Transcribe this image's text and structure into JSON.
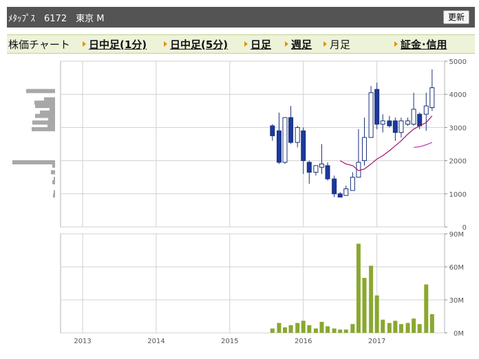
{
  "header": {
    "title": "ﾒﾀｯﾌﾟｽ　6172　東京 M",
    "refresh_label": "更新"
  },
  "nav": {
    "label": "株価チャート",
    "items": [
      {
        "label": "日中足(1分)",
        "link": true
      },
      {
        "label": "日中足(5分)",
        "link": true
      },
      {
        "label": "日足",
        "link": true
      },
      {
        "label": "週足",
        "link": true
      },
      {
        "label": "月足",
        "link": false
      },
      {
        "label": "証金･信用",
        "link": true
      }
    ]
  },
  "chart_data": [
    {
      "type": "candlestick",
      "name": "price",
      "ylim": [
        0,
        5000
      ],
      "yticks": [
        "0",
        "1000",
        "2000",
        "3000",
        "4000",
        "5000"
      ],
      "x_range": [
        2012.7,
        2017.92
      ],
      "xticks": [
        "2013",
        "2014",
        "2015",
        "2016",
        "2017"
      ],
      "candles": [
        {
          "x": 2015.58,
          "o": 3050,
          "h": 3100,
          "l": 2600,
          "c": 2750
        },
        {
          "x": 2015.67,
          "o": 2900,
          "h": 3450,
          "l": 1900,
          "c": 1950
        },
        {
          "x": 2015.75,
          "o": 1950,
          "h": 3300,
          "l": 1900,
          "c": 3300
        },
        {
          "x": 2015.83,
          "o": 3300,
          "h": 3650,
          "l": 2500,
          "c": 2550
        },
        {
          "x": 2015.92,
          "o": 2550,
          "h": 3050,
          "l": 2400,
          "c": 3000
        },
        {
          "x": 2016.0,
          "o": 2900,
          "h": 3000,
          "l": 1600,
          "c": 2000
        },
        {
          "x": 2016.08,
          "o": 1950,
          "h": 2000,
          "l": 1300,
          "c": 1650
        },
        {
          "x": 2016.17,
          "o": 1650,
          "h": 1850,
          "l": 1550,
          "c": 1850
        },
        {
          "x": 2016.25,
          "o": 1800,
          "h": 2500,
          "l": 1600,
          "c": 1900
        },
        {
          "x": 2016.33,
          "o": 1850,
          "h": 1950,
          "l": 1400,
          "c": 1450
        },
        {
          "x": 2016.42,
          "o": 1450,
          "h": 1550,
          "l": 900,
          "c": 1000
        },
        {
          "x": 2016.5,
          "o": 1000,
          "h": 1050,
          "l": 900,
          "c": 900
        },
        {
          "x": 2016.58,
          "o": 950,
          "h": 1250,
          "l": 950,
          "c": 1150
        },
        {
          "x": 2016.67,
          "o": 1100,
          "h": 1650,
          "l": 1100,
          "c": 1500
        },
        {
          "x": 2016.75,
          "o": 1500,
          "h": 2950,
          "l": 1500,
          "c": 1950
        },
        {
          "x": 2016.83,
          "o": 2000,
          "h": 3300,
          "l": 1850,
          "c": 2700
        },
        {
          "x": 2016.92,
          "o": 2700,
          "h": 4250,
          "l": 2700,
          "c": 4050
        },
        {
          "x": 2017.0,
          "o": 4150,
          "h": 4350,
          "l": 2950,
          "c": 3100
        },
        {
          "x": 2017.08,
          "o": 3100,
          "h": 3400,
          "l": 2850,
          "c": 3200
        },
        {
          "x": 2017.17,
          "o": 3200,
          "h": 3350,
          "l": 3000,
          "c": 3050
        },
        {
          "x": 2017.25,
          "o": 3200,
          "h": 3300,
          "l": 2600,
          "c": 2850
        },
        {
          "x": 2017.33,
          "o": 2850,
          "h": 3300,
          "l": 2700,
          "c": 3200
        },
        {
          "x": 2017.42,
          "o": 3100,
          "h": 3300,
          "l": 3050,
          "c": 3200
        },
        {
          "x": 2017.5,
          "o": 3100,
          "h": 4050,
          "l": 3050,
          "c": 3550
        },
        {
          "x": 2017.58,
          "o": 3400,
          "h": 3450,
          "l": 2950,
          "c": 3050
        },
        {
          "x": 2017.67,
          "o": 3400,
          "h": 4050,
          "l": 2900,
          "c": 3650
        },
        {
          "x": 2017.75,
          "o": 3600,
          "h": 4750,
          "l": 3500,
          "c": 4200
        }
      ],
      "ma_lines": [
        {
          "color": "#a0106a",
          "points": [
            [
              2016.5,
              2000
            ],
            [
              2016.58,
              1900
            ],
            [
              2016.67,
              1850
            ],
            [
              2016.75,
              1700
            ],
            [
              2016.83,
              1750
            ],
            [
              2016.92,
              1900
            ],
            [
              2017.0,
              2050
            ],
            [
              2017.08,
              2150
            ],
            [
              2017.17,
              2300
            ],
            [
              2017.25,
              2450
            ],
            [
              2017.33,
              2600
            ],
            [
              2017.42,
              2800
            ],
            [
              2017.5,
              2950
            ],
            [
              2017.58,
              3050
            ],
            [
              2017.67,
              3150
            ],
            [
              2017.75,
              3350
            ]
          ]
        },
        {
          "color": "#c030c0",
          "points": [
            [
              2017.5,
              2400
            ],
            [
              2017.58,
              2420
            ],
            [
              2017.67,
              2480
            ],
            [
              2017.75,
              2550
            ]
          ]
        }
      ],
      "price_profile": [
        {
          "price": 4100,
          "len": 42
        },
        {
          "price": 3850,
          "len": 16
        },
        {
          "price": 3750,
          "len": 30
        },
        {
          "price": 3650,
          "len": 29
        },
        {
          "price": 3550,
          "len": 8
        },
        {
          "price": 3450,
          "len": 22
        },
        {
          "price": 3350,
          "len": 29
        },
        {
          "price": 3250,
          "len": 10
        },
        {
          "price": 3150,
          "len": 33
        },
        {
          "price": 3050,
          "len": 11
        },
        {
          "price": 2950,
          "len": 34
        },
        {
          "price": 1950,
          "len": 62
        },
        {
          "price": 1850,
          "len": 4
        },
        {
          "price": 1650,
          "len": 6
        },
        {
          "price": 1450,
          "len": 2
        },
        {
          "price": 1350,
          "len": 4
        },
        {
          "price": 1050,
          "len": 2
        },
        {
          "price": 950,
          "len": 3
        }
      ]
    },
    {
      "type": "bar",
      "name": "volume",
      "ylim": [
        0,
        90
      ],
      "yticks": [
        "0M",
        "30M",
        "60M",
        "90M"
      ],
      "bar_color": "#8aa830",
      "x": [
        2015.58,
        2015.67,
        2015.75,
        2015.83,
        2015.92,
        2016.0,
        2016.08,
        2016.17,
        2016.25,
        2016.33,
        2016.42,
        2016.5,
        2016.58,
        2016.67,
        2016.75,
        2016.83,
        2016.92,
        2017.0,
        2017.08,
        2017.17,
        2017.25,
        2017.33,
        2017.42,
        2017.5,
        2017.58,
        2017.67,
        2017.75
      ],
      "values": [
        4,
        9,
        5,
        7,
        9,
        11,
        7,
        4,
        10,
        6,
        4,
        3,
        3,
        8,
        81,
        50,
        61,
        34,
        12,
        9,
        11,
        8,
        9,
        13,
        8,
        44,
        17
      ]
    }
  ]
}
